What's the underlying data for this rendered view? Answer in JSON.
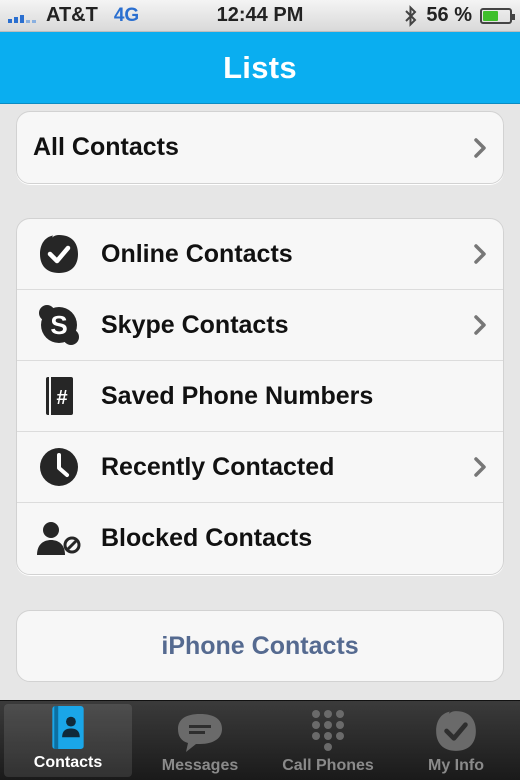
{
  "status_bar": {
    "carrier": "AT&T",
    "network": "4G",
    "time": "12:44 PM",
    "battery": "56 %",
    "battery_level": 0.56,
    "icons": [
      "signal-icon",
      "bluetooth-icon",
      "battery-icon"
    ]
  },
  "nav": {
    "title": "Lists"
  },
  "lists": {
    "all_contacts": "All Contacts",
    "items": [
      {
        "label": "Online Contacts",
        "icon": "online-check-icon",
        "chevron": true
      },
      {
        "label": "Skype Contacts",
        "icon": "skype-icon",
        "chevron": true
      },
      {
        "label": "Saved Phone Numbers",
        "icon": "phonebook-hash-icon",
        "chevron": false
      },
      {
        "label": "Recently Contacted",
        "icon": "clock-icon",
        "chevron": true
      },
      {
        "label": "Blocked Contacts",
        "icon": "blocked-user-icon",
        "chevron": false
      }
    ],
    "iphone_contacts": "iPhone Contacts"
  },
  "tabbar": {
    "tabs": [
      {
        "label": "Contacts",
        "icon": "contacts-book-icon",
        "active": true
      },
      {
        "label": "Messages",
        "icon": "chat-bubble-icon",
        "active": false
      },
      {
        "label": "Call Phones",
        "icon": "dialpad-icon",
        "active": false
      },
      {
        "label": "My Info",
        "icon": "my-info-check-icon",
        "active": false
      }
    ]
  },
  "colors": {
    "accent": "#0aaef0",
    "link_text": "#556a90",
    "tab_bar": "#2a2a2a",
    "active_tab_icon": "#1aa6e8"
  }
}
